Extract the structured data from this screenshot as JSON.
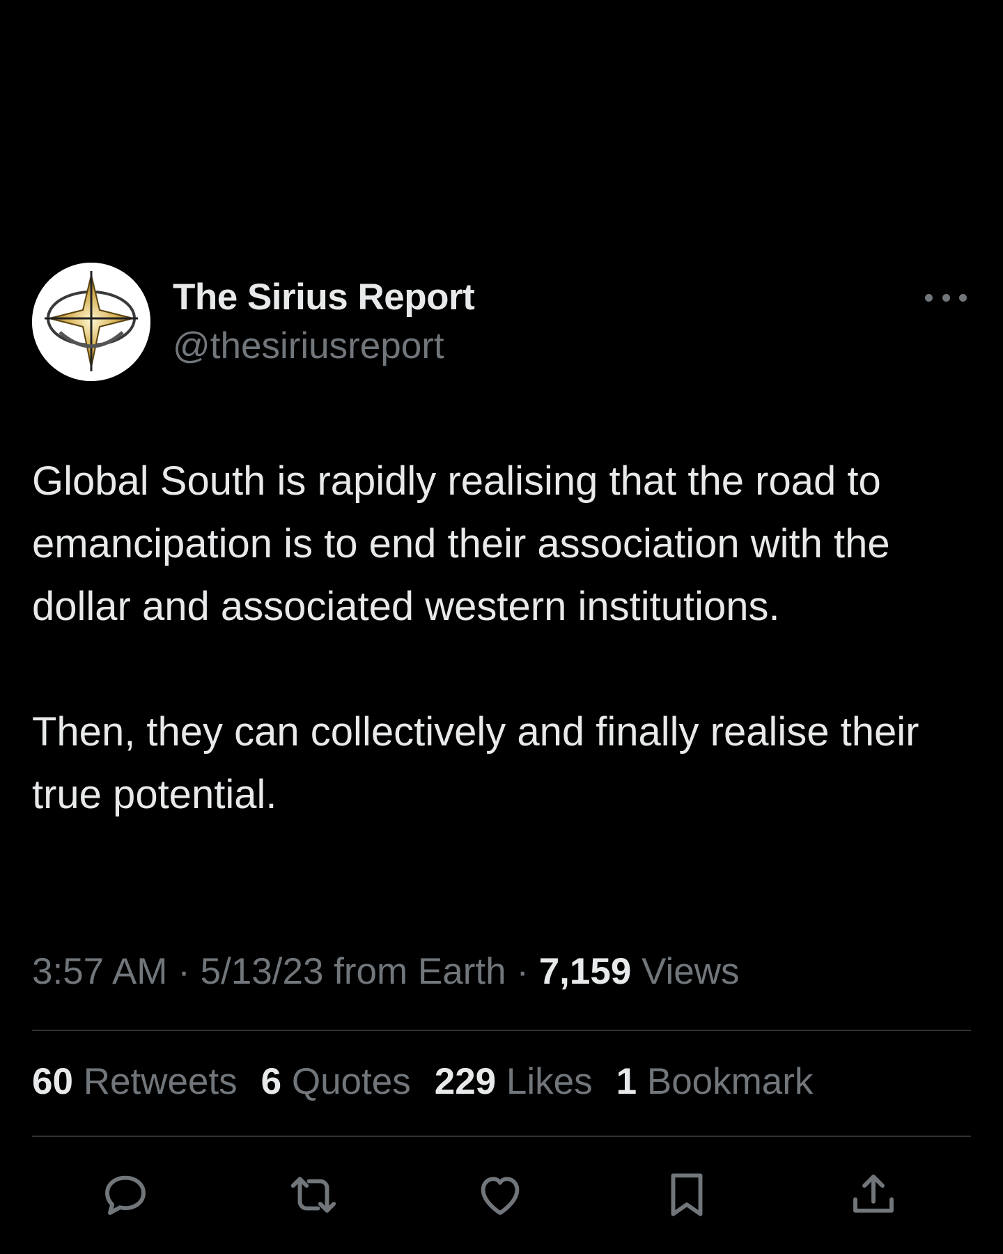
{
  "tweet": {
    "display_name": "The Sirius Report",
    "handle": "@thesiriusreport",
    "avatar_icon": "compass-star-logo",
    "more_icon": "more-options-icon",
    "body": {
      "paragraph_1": "Global South is rapidly realising that the road to emancipation is to end their association with the dollar and associated western institutions.",
      "paragraph_2": "Then, they can collectively and finally realise their true potential."
    },
    "meta": {
      "time": "3:57 AM",
      "separator": "·",
      "date": "5/13/23",
      "source": "from Earth",
      "views_count": "7,159",
      "views_label": "Views"
    },
    "stats": {
      "retweets_count": "60",
      "retweets_label": "Retweets",
      "quotes_count": "6",
      "quotes_label": "Quotes",
      "likes_count": "229",
      "likes_label": "Likes",
      "bookmarks_count": "1",
      "bookmarks_label": "Bookmark"
    },
    "actions": [
      "reply-icon",
      "retweet-icon",
      "like-icon",
      "bookmark-icon",
      "share-icon"
    ]
  },
  "colors": {
    "background": "#000000",
    "primary_text": "#e7e9ea",
    "secondary_text": "#71767b",
    "divider": "#2f3336",
    "logo_gold": "#c9a84a"
  }
}
